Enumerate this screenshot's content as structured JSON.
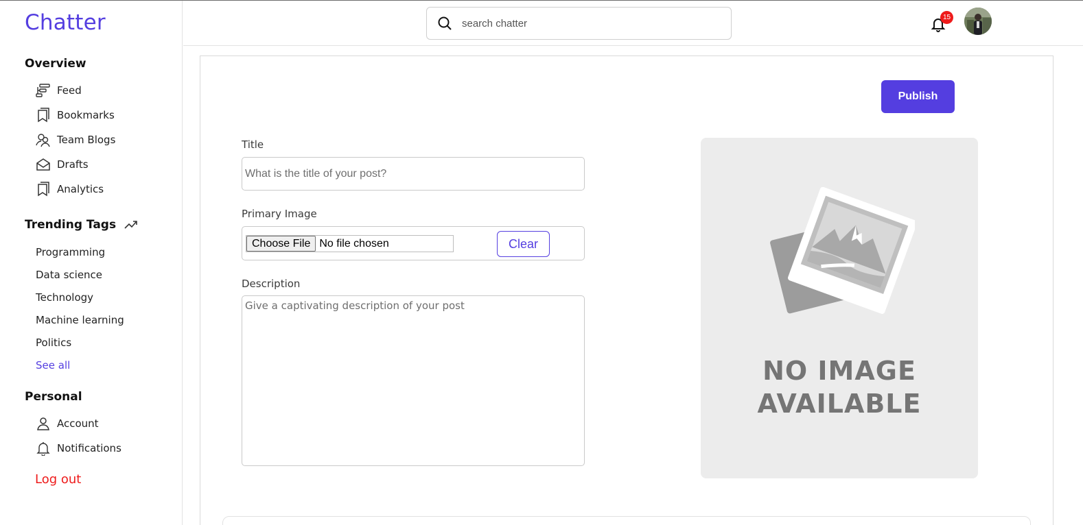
{
  "app": {
    "name": "Chatter"
  },
  "sidebar": {
    "overview_title": "Overview",
    "overview_items": [
      {
        "label": "Feed",
        "icon": "feed-icon"
      },
      {
        "label": "Bookmarks",
        "icon": "bookmark-icon"
      },
      {
        "label": "Team Blogs",
        "icon": "team-icon"
      },
      {
        "label": "Drafts",
        "icon": "envelope-icon"
      },
      {
        "label": "Analytics",
        "icon": "bookmark-icon"
      }
    ],
    "trending_title": "Trending Tags",
    "trending_tags": [
      "Programming",
      "Data science",
      "Technology",
      "Machine learning",
      "Politics"
    ],
    "see_all": "See all",
    "personal_title": "Personal",
    "personal_items": [
      {
        "label": "Account",
        "icon": "user-icon"
      },
      {
        "label": "Notifications",
        "icon": "bell-icon"
      }
    ],
    "logout": "Log out"
  },
  "header": {
    "search_placeholder": "search chatter",
    "notification_count": "15"
  },
  "editor": {
    "publish_label": "Publish",
    "title_label": "Title",
    "title_placeholder": "What is the title of your post?",
    "image_label": "Primary Image",
    "choose_file_label": "Choose File",
    "no_file_text": "No file chosen",
    "clear_label": "Clear",
    "description_label": "Description",
    "description_placeholder": "Give a captivating description of your post",
    "preview_line1": "NO IMAGE",
    "preview_line2": "AVAILABLE"
  },
  "colors": {
    "accent": "#543ee0",
    "danger": "#ee1b1b",
    "preview_bg": "#ececec"
  }
}
